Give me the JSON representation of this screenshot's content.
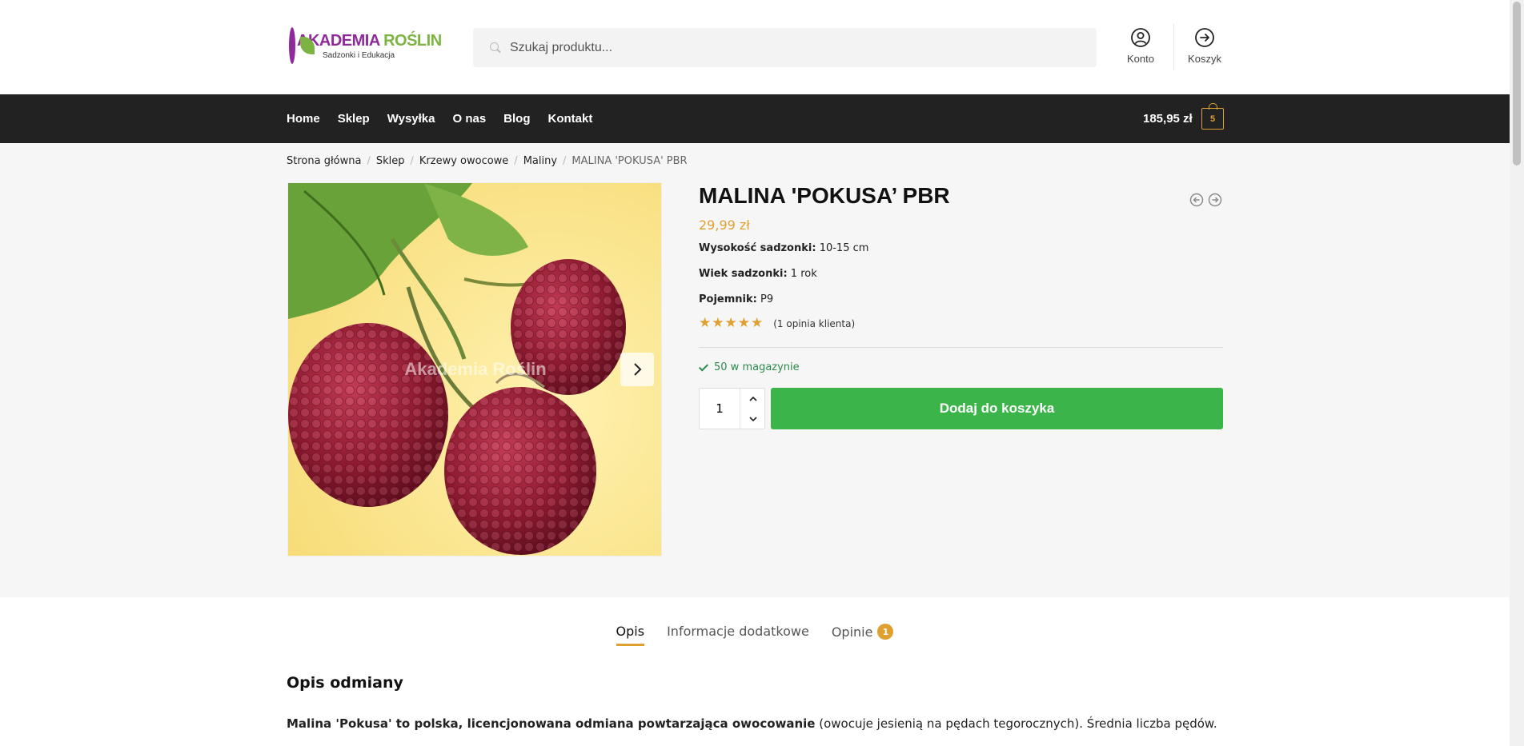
{
  "header": {
    "logo_title_a": "AKADEMIA ",
    "logo_title_b": "ROŚLIN",
    "logo_subtitle": "Sadzonki i Edukacja",
    "search_placeholder": "Szukaj produktu...",
    "account_label": "Konto",
    "cart_label": "Koszyk"
  },
  "nav": {
    "items": [
      {
        "label": "Home"
      },
      {
        "label": "Sklep"
      },
      {
        "label": "Wysyłka"
      },
      {
        "label": "O nas"
      },
      {
        "label": "Blog"
      },
      {
        "label": "Kontakt"
      }
    ],
    "cart_total": "185,95 zł",
    "cart_count": "5"
  },
  "breadcrumb": [
    "Strona główna",
    "Sklep",
    "Krzewy owocowe",
    "Maliny",
    "MALINA 'POKUSA' PBR"
  ],
  "gallery": {
    "watermark": "Akademia Roślin"
  },
  "product": {
    "title": "MALINA 'POKUSA’ PBR",
    "price": "29,99 zł",
    "attributes": [
      {
        "label": "Wysokość sadzonki:",
        "value": "10-15 cm"
      },
      {
        "label": "Wiek sadzonki:",
        "value": "1 rok"
      },
      {
        "label": "Pojemnik:",
        "value": "P9"
      }
    ],
    "rating": 5,
    "reviews_link": "(1 opinia klienta)",
    "stock": "50 w magazynie",
    "quantity": "1",
    "add_to_cart": "Dodaj do koszyka"
  },
  "tabs": [
    {
      "label": "Opis"
    },
    {
      "label": "Informacje dodatkowe"
    },
    {
      "label": "Opinie",
      "badge": "1"
    }
  ],
  "description": {
    "heading": "Opis odmiany",
    "intro_bold": "Malina 'Pokusa' to polska, licencjonowana odmiana powtarzająca owocowanie",
    "intro_rest": " (owocuje jesienią na pędach tegorocznych). Średnia liczba pędów."
  },
  "colors": {
    "accent": "#e0a030",
    "button": "#3bb54a",
    "nav_bg": "#222222",
    "brand_purple": "#8e2a9a",
    "brand_green": "#7cb342"
  }
}
